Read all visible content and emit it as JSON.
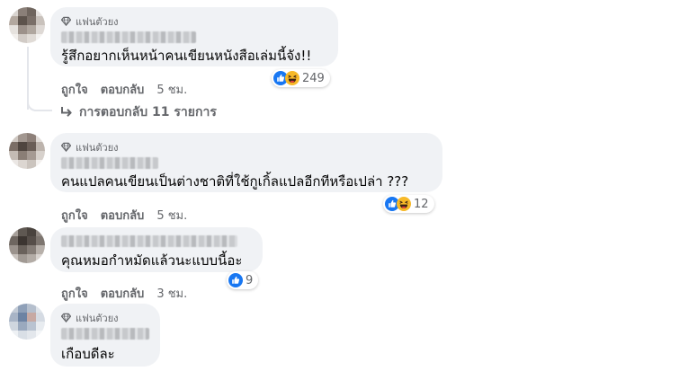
{
  "comments": [
    {
      "badge": "แฟนตัวยง",
      "text": "รู้สึกอยากเห็นหน้าคนเขียนหนังสือเล่มนี้จัง!!",
      "like_label": "ถูกใจ",
      "reply_label": "ตอบกลับ",
      "time": "5 ชม.",
      "reaction_count": "249",
      "reactions": [
        "like-icon",
        "haha-icon"
      ],
      "replies_label": "การตอบกลับ 11 รายการ"
    },
    {
      "badge": "แฟนตัวยง",
      "text": "คนแปลคนเขียนเป็นต่างชาติที่ใช้กูเกิ้ลแปลอีกทีหรือเปล่า ???",
      "like_label": "ถูกใจ",
      "reply_label": "ตอบกลับ",
      "time": "5 ชม.",
      "reaction_count": "12",
      "reactions": [
        "like-icon",
        "haha-icon"
      ]
    },
    {
      "text": "คุณหมอกำหมัดแล้วนะแบบนี้อะ",
      "like_label": "ถูกใจ",
      "reply_label": "ตอบกลับ",
      "time": "3 ชม.",
      "reaction_count": "9",
      "reactions": [
        "like-icon"
      ]
    },
    {
      "badge": "แฟนตัวยง",
      "text": "เกือบดีละ"
    }
  ],
  "colors": {
    "bubble": "#f0f2f5",
    "secondary_text": "#65676b",
    "like_blue": "#1877f2",
    "haha_yellow": "#f7b928"
  }
}
